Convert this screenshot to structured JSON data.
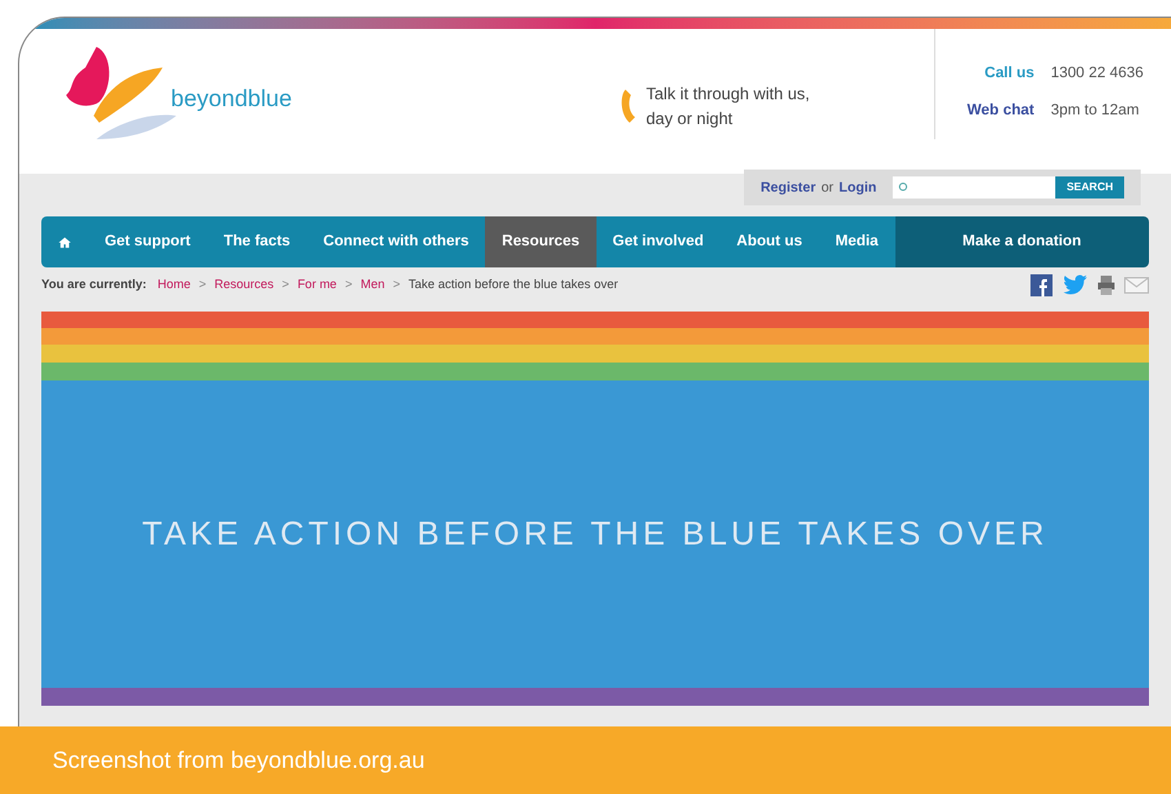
{
  "header": {
    "logo_text": "beyondblue",
    "tagline": "Talk it through with us, day or night",
    "contacts": [
      {
        "label": "Call us",
        "value": "1300 22 4636",
        "kind": "call"
      },
      {
        "label": "Web chat",
        "value": "3pm to 12am",
        "kind": "chat"
      }
    ]
  },
  "account": {
    "register": "Register",
    "separator": "or",
    "login": "Login"
  },
  "search": {
    "button": "SEARCH"
  },
  "nav": [
    {
      "kind": "home",
      "selected": false
    },
    {
      "kind": "link",
      "label": "Get support",
      "selected": false
    },
    {
      "kind": "link",
      "label": "The facts",
      "selected": false
    },
    {
      "kind": "link",
      "label": "Connect with others",
      "selected": false
    },
    {
      "kind": "link",
      "label": "Resources",
      "selected": true
    },
    {
      "kind": "link",
      "label": "Get involved",
      "selected": false
    },
    {
      "kind": "link",
      "label": "About us",
      "selected": false
    },
    {
      "kind": "link",
      "label": "Media",
      "selected": false
    },
    {
      "kind": "donation",
      "label": "Make a donation",
      "selected": false
    }
  ],
  "breadcrumb": {
    "prefix": "You are currently:",
    "items": [
      "Home",
      "Resources",
      "For me",
      "Men"
    ],
    "current": "Take action before the blue takes over",
    "separator": ">"
  },
  "banner": {
    "title": "TAKE ACTION BEFORE THE BLUE TAKES OVER"
  },
  "caption": "Screenshot from beyondblue.org.au"
}
